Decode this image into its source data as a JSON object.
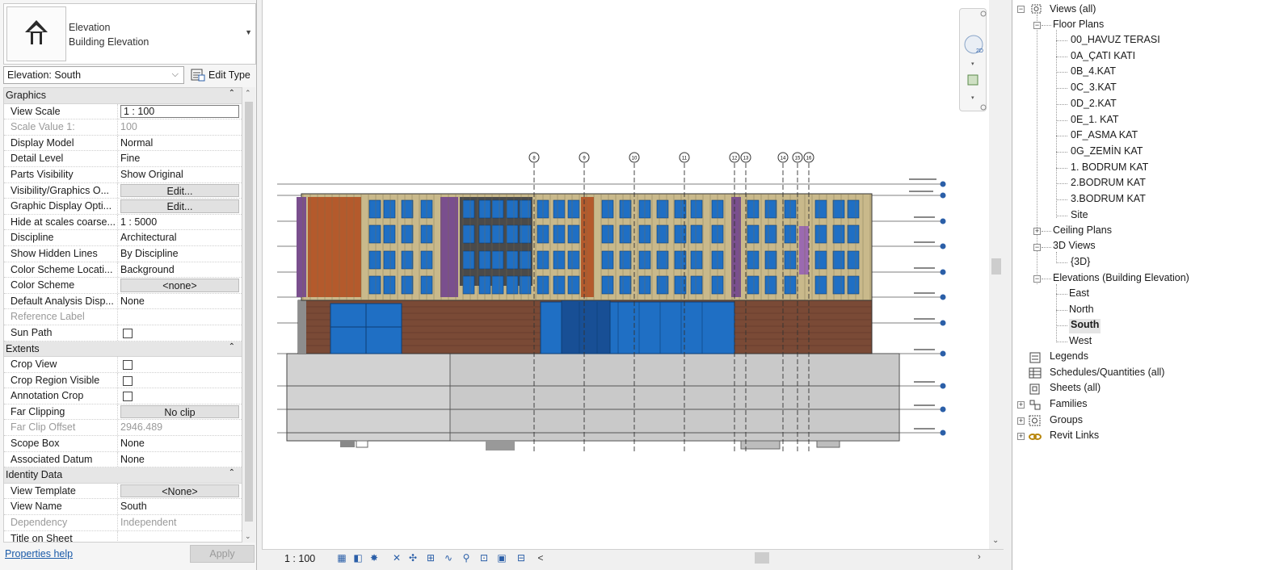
{
  "type_selector": {
    "family": "Elevation",
    "type": "Building Elevation"
  },
  "instance": {
    "selected": "Elevation: South",
    "edit_type_label": "Edit Type"
  },
  "sections": {
    "graphics": "Graphics",
    "extents": "Extents",
    "identity": "Identity Data"
  },
  "graphics_rows": [
    {
      "label": "View Scale",
      "value": "1 : 100"
    },
    {
      "label": "Scale Value    1:",
      "value": "100"
    },
    {
      "label": "Display Model",
      "value": "Normal"
    },
    {
      "label": "Detail Level",
      "value": "Fine"
    },
    {
      "label": "Parts Visibility",
      "value": "Show Original"
    },
    {
      "label": "Visibility/Graphics O...",
      "value": "Edit..."
    },
    {
      "label": "Graphic Display Opti...",
      "value": "Edit..."
    },
    {
      "label": "Hide at scales coarse...",
      "value": "1 : 5000"
    },
    {
      "label": "Discipline",
      "value": "Architectural"
    },
    {
      "label": "Show Hidden Lines",
      "value": "By Discipline"
    },
    {
      "label": "Color Scheme Locati...",
      "value": "Background"
    },
    {
      "label": "Color Scheme",
      "value": "<none>"
    },
    {
      "label": "Default Analysis Disp...",
      "value": "None"
    },
    {
      "label": "Reference Label",
      "value": ""
    },
    {
      "label": "Sun Path",
      "value": ""
    }
  ],
  "extents_rows": [
    {
      "label": "Crop View",
      "value": ""
    },
    {
      "label": "Crop Region Visible",
      "value": ""
    },
    {
      "label": "Annotation Crop",
      "value": ""
    },
    {
      "label": "Far Clipping",
      "value": "No clip"
    },
    {
      "label": "Far Clip Offset",
      "value": "2946.489"
    },
    {
      "label": "Scope Box",
      "value": "None"
    },
    {
      "label": "Associated Datum",
      "value": "None"
    }
  ],
  "identity_rows": [
    {
      "label": "View Template",
      "value": "<None>"
    },
    {
      "label": "View Name",
      "value": "South"
    },
    {
      "label": "Dependency",
      "value": "Independent"
    },
    {
      "label": "Title on Sheet",
      "value": ""
    }
  ],
  "footer": {
    "help_link": "Properties help",
    "apply": "Apply"
  },
  "view_bar": {
    "scale": "1 : 100",
    "collapse_glyph": "<"
  },
  "browser": {
    "views_root": "Views (all)",
    "floor_plans": "Floor Plans",
    "floor_plan_items": [
      "00_HAVUZ TERASI",
      "0A_ÇATI KATI",
      "0B_4.KAT",
      "0C_3.KAT",
      "0D_2.KAT",
      "0E_1. KAT",
      "0F_ASMA KAT",
      "0G_ZEMİN KAT",
      "1. BODRUM KAT",
      "2.BODRUM KAT",
      "3.BODRUM KAT",
      "Site"
    ],
    "ceiling_plans": "Ceiling Plans",
    "views_3d": "3D Views",
    "view_3d_item": "{3D}",
    "elevations": "Elevations (Building Elevation)",
    "elevation_items": [
      "East",
      "North",
      "South",
      "West"
    ],
    "legends": "Legends",
    "schedules": "Schedules/Quantities (all)",
    "sheets": "Sheets (all)",
    "families": "Families",
    "groups": "Groups",
    "revit_links": "Revit Links"
  },
  "grid_bubbles": [
    "8",
    "9",
    "10",
    "11",
    "12",
    "13",
    "14",
    "15",
    "16"
  ],
  "colors": {
    "accent_link": "#1a5aa8",
    "facade_beige": "#c9b98b",
    "facade_orange": "#b45a2c",
    "facade_purple": "#7a4f8e",
    "glass_blue": "#1f6fc4",
    "brick_brown": "#7a4a36",
    "podium_gray": "#cfcfcf"
  }
}
